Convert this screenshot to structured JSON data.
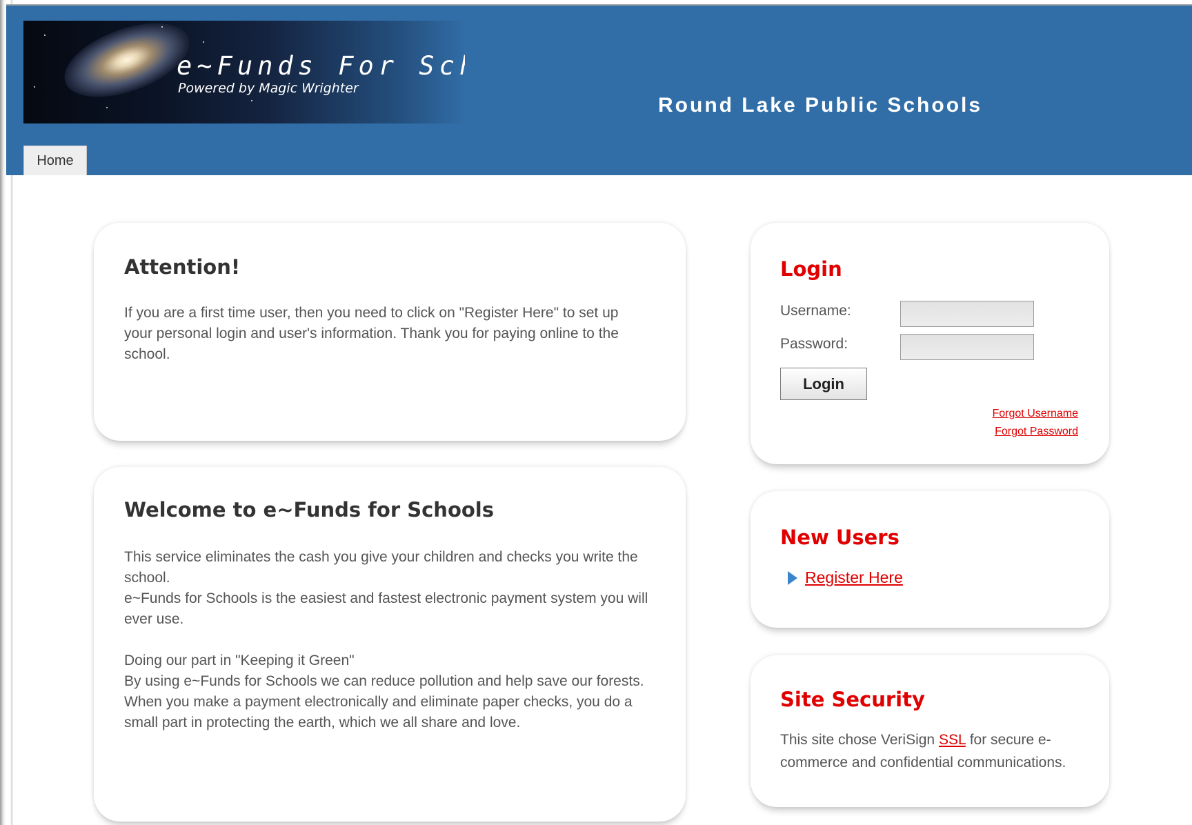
{
  "header": {
    "banner_title": "e~Funds For Schools",
    "banner_subtitle": "Powered by Magic Wrighter",
    "district_name": "Round Lake Public Schools",
    "color": "#316da6"
  },
  "tabs": [
    {
      "label": "Home",
      "active": true
    }
  ],
  "attention": {
    "title": "Attention!",
    "body": "If you are a first time user, then you need to click on \"Register Here\" to set up your personal login and user's information. Thank you for paying online to the school."
  },
  "welcome": {
    "title": "Welcome to e~Funds for Schools",
    "line1": "This service eliminates the cash you give your children and checks you write the school.",
    "line2": "e~Funds for Schools is the easiest and fastest electronic payment system you will ever use.",
    "green_heading": "Doing our part in \"Keeping it Green\"",
    "line3": "By using e~Funds for Schools we can reduce pollution and help save our forests. When you make a payment electronically and eliminate paper checks, you do a small part in protecting the earth, which we all share and love."
  },
  "login": {
    "title": "Login",
    "username_label": "Username:",
    "password_label": "Password:",
    "username_value": "",
    "password_value": "",
    "button_label": "Login",
    "forgot_username": "Forgot Username",
    "forgot_password": "Forgot Password"
  },
  "new_users": {
    "title": "New Users",
    "register_link": "Register Here"
  },
  "security": {
    "title": "Site Security",
    "text_before": "This site chose VeriSign ",
    "ssl_link": "SSL",
    "text_after": " for secure e-commerce and confidential communications."
  },
  "colors": {
    "accent_red": "#e00000",
    "green": "#1c9a1c"
  }
}
